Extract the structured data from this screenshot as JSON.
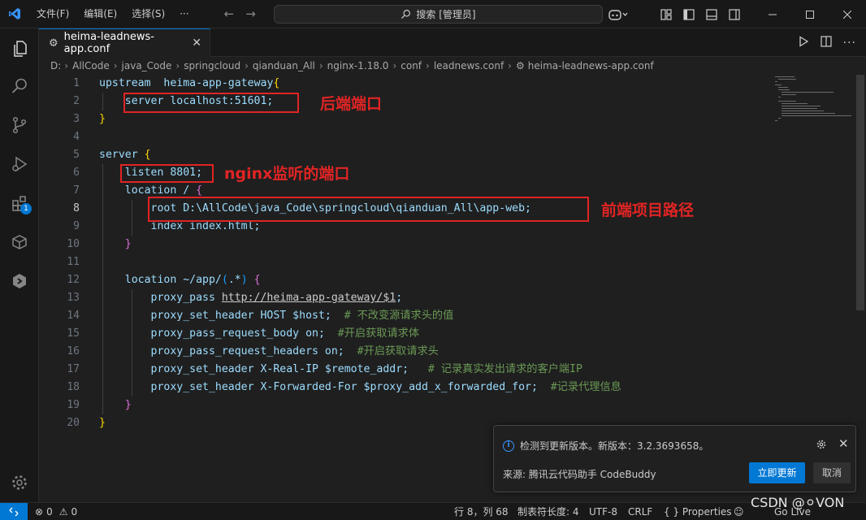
{
  "titlebar": {
    "menus": [
      "文件(F)",
      "编辑(E)",
      "选择(S)",
      "···"
    ],
    "search": "搜索 [管理员]"
  },
  "tab": {
    "label": "heima-leadnews-app.conf"
  },
  "breadcrumb": [
    "D:",
    "AllCode",
    "java_Code",
    "springcloud",
    "qianduan_All",
    "nginx-1.18.0",
    "conf",
    "leadnews.conf",
    "heima-leadnews-app.conf"
  ],
  "activity": {
    "extensions_badge": "1"
  },
  "editor": {
    "line_numbers": [
      "1",
      "2",
      "3",
      "4",
      "5",
      "6",
      "7",
      "8",
      "9",
      "10",
      "11",
      "12",
      "13",
      "14",
      "15",
      "16",
      "17",
      "18",
      "19",
      "20"
    ],
    "current_line": 8,
    "lines": {
      "l1_kw": "upstream",
      "l1_name": "  heima-app-gateway",
      "l1_brace": "{",
      "l2_text": "    server localhost:51601;",
      "l3_brace": "}",
      "l5_kw": "server ",
      "l5_brace": "{",
      "l6_text": "    listen 8801;",
      "l7_text": "    location / ",
      "l7_brace": "{",
      "l8_text": "        root D:\\AllCode\\java_Code\\springcloud\\qianduan_All\\app-web;",
      "l9_text": "        index index.html;",
      "l10_brace": "    }",
      "l12_a": "    location ~/app/",
      "l12_p": "(",
      "l12_b": ".*",
      "l12_pc": ")",
      "l12_brace": " {",
      "l13_a": "        proxy_pass ",
      "l13_url": "http://heima-app-gateway/$1",
      "l13_b": ";",
      "l14_a": "        proxy_set_header HOST $host;  ",
      "l14_cm": "# 不改变源请求头的值",
      "l15_a": "        proxy_pass_request_body on;  ",
      "l15_cm": "#开启获取请求体",
      "l16_a": "        proxy_pass_request_headers on;  ",
      "l16_cm": "#开启获取请求头",
      "l17_a": "        proxy_set_header X-Real-IP $remote_addr;   ",
      "l17_cm": "# 记录真实发出请求的客户端IP",
      "l18_a": "        proxy_set_header X-Forwarded-For $proxy_add_x_forwarded_for;  ",
      "l18_cm": "#记录代理信息",
      "l19_brace": "    }",
      "l20_brace": "}"
    }
  },
  "annotations": {
    "backend_port": "后端端口",
    "nginx_port": "nginx监听的端口",
    "frontend_path": "前端项目路径"
  },
  "notification": {
    "message": "检测到更新版本。新版本：3.2.3693658。",
    "source": "来源: 腾讯云代码助手 CodeBuddy",
    "update_label": "立即更新",
    "cancel_label": "取消"
  },
  "statusbar": {
    "errors": "0",
    "warnings": "0",
    "position": "行 8，列 68",
    "tab_size": "制表符长度: 4",
    "encoding": "UTF-8",
    "eol": "CRLF",
    "language": "{ } Properties",
    "golive": "Go Live"
  },
  "watermark": "CSDN @⚪VON",
  "colors": {
    "accent": "#0078d4",
    "annotation_red": "#e02424",
    "comment": "#6a9955",
    "key": "#9cdcfe"
  }
}
